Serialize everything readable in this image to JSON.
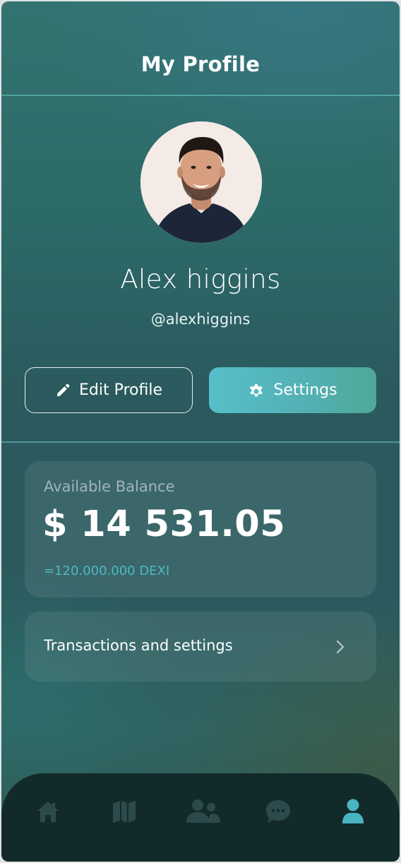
{
  "header": {
    "title": "My Profile"
  },
  "profile": {
    "name": "Alex higgins",
    "handle": "@alexhiggins"
  },
  "actions": {
    "edit_label": "Edit Profile",
    "edit_icon": "pencil-icon",
    "settings_label": "Settings",
    "settings_icon": "gear-icon"
  },
  "balance": {
    "label": "Available Balance",
    "amount": "$ 14 531.05",
    "equivalent": "=120.000.000 DEXI"
  },
  "transactions": {
    "label": "Transactions and settings",
    "icon": "chevron-right-icon"
  },
  "bottom_nav": {
    "items": [
      {
        "icon": "home-icon",
        "active": false
      },
      {
        "icon": "map-icon",
        "active": false
      },
      {
        "icon": "users-icon",
        "active": false
      },
      {
        "icon": "chat-icon",
        "active": false
      },
      {
        "icon": "user-icon",
        "active": true
      }
    ]
  },
  "colors": {
    "accent": "#4fb8c0",
    "nav_background": "#132a2b",
    "nav_inactive": "#2c4a4b",
    "nav_active": "#4ab5c0"
  }
}
